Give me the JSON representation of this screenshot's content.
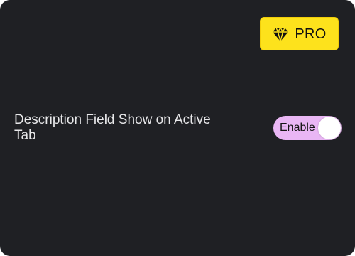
{
  "badge": {
    "label": "PRO",
    "icon": "diamond-icon",
    "background": "#fde21c"
  },
  "setting": {
    "label": "Description Field Show on Active Tab",
    "toggle": {
      "label": "Enable",
      "state": true,
      "track_color": "#e9b6f4",
      "knob_color": "#ffffff"
    }
  },
  "colors": {
    "panel_background": "#1f2024",
    "text": "#e8e8ea"
  }
}
